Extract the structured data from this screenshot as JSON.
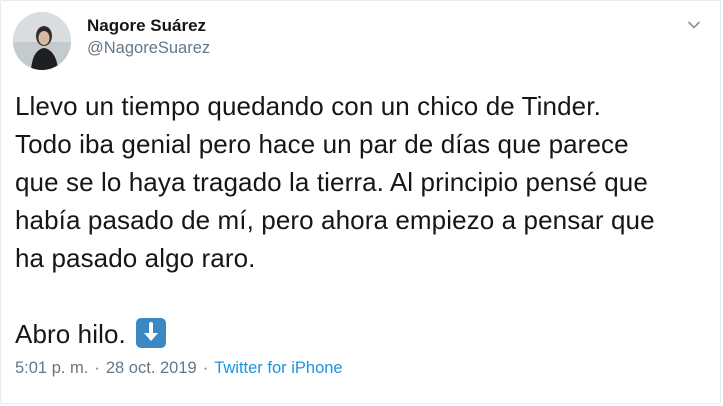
{
  "author": {
    "display_name": "Nagore Suárez",
    "handle": "@NagoreSuarez"
  },
  "tweet": {
    "paragraph_1": "Llevo un tiempo quedando con un chico de Tinder.\nTodo iba genial pero hace un par de días que parece\nque se lo haya tragado la tierra. Al principio pensé que\nhabía pasado de mí, pero ahora empiezo a pensar que\nha pasado algo raro.",
    "paragraph_2": "Abro hilo."
  },
  "meta": {
    "time": "5:01 p. m.",
    "separator": "·",
    "date": "28 oct. 2019",
    "source": "Twitter for iPhone"
  },
  "icons": {
    "caret": "chevron-down-icon",
    "emoji": "down-arrow-emoji-icon"
  },
  "colors": {
    "link": "#1b95e0",
    "muted": "#657786",
    "text": "#14171a",
    "emoji_blue": "#3b88c3"
  }
}
